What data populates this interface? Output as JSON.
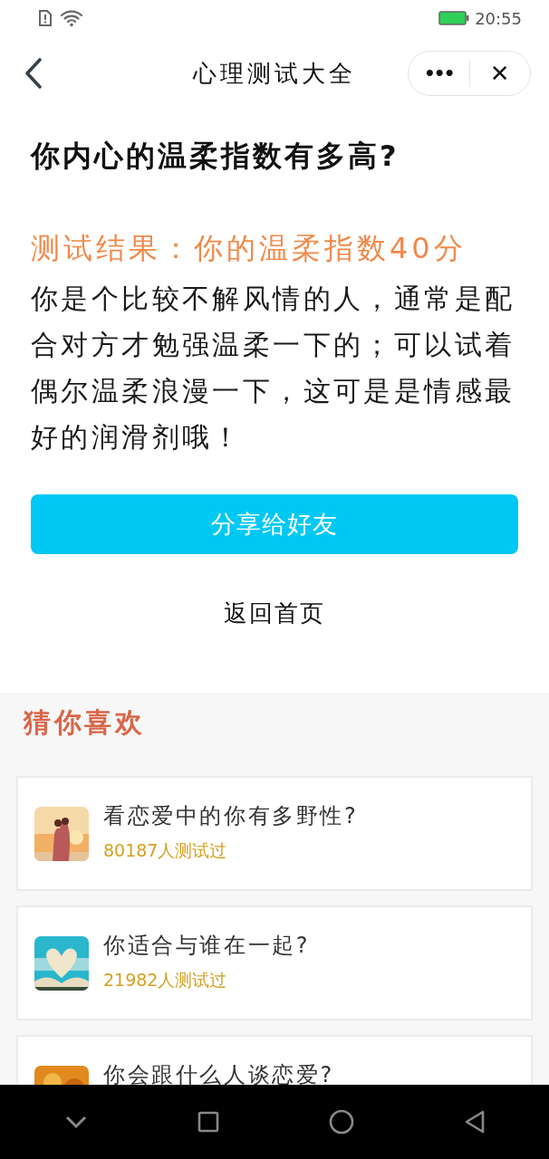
{
  "status_bar": {
    "time": "20:55"
  },
  "nav": {
    "title": "心理测试大全",
    "more": "•••",
    "close": "✕"
  },
  "quiz": {
    "title": "你内心的温柔指数有多高?",
    "result": "测试结果：你的温柔指数40分",
    "description": "你是个比较不解风情的人，通常是配合对方才勉强温柔一下的；可以试着偶尔温柔浪漫一下，这可是是情感最好的润滑剂哦！",
    "share_button": "分享给好友",
    "home_link": "返回首页"
  },
  "recommend": {
    "heading": "猜你喜欢",
    "items": [
      {
        "title": "看恋爱中的你有多野性?",
        "count": "80187人测试过",
        "kind": "picture"
      },
      {
        "title": "你适合与谁在一起?",
        "count": "21982人测试过",
        "kind": "picture"
      },
      {
        "title": "你会跟什么人谈恋爱?",
        "kind": "picture"
      }
    ]
  }
}
